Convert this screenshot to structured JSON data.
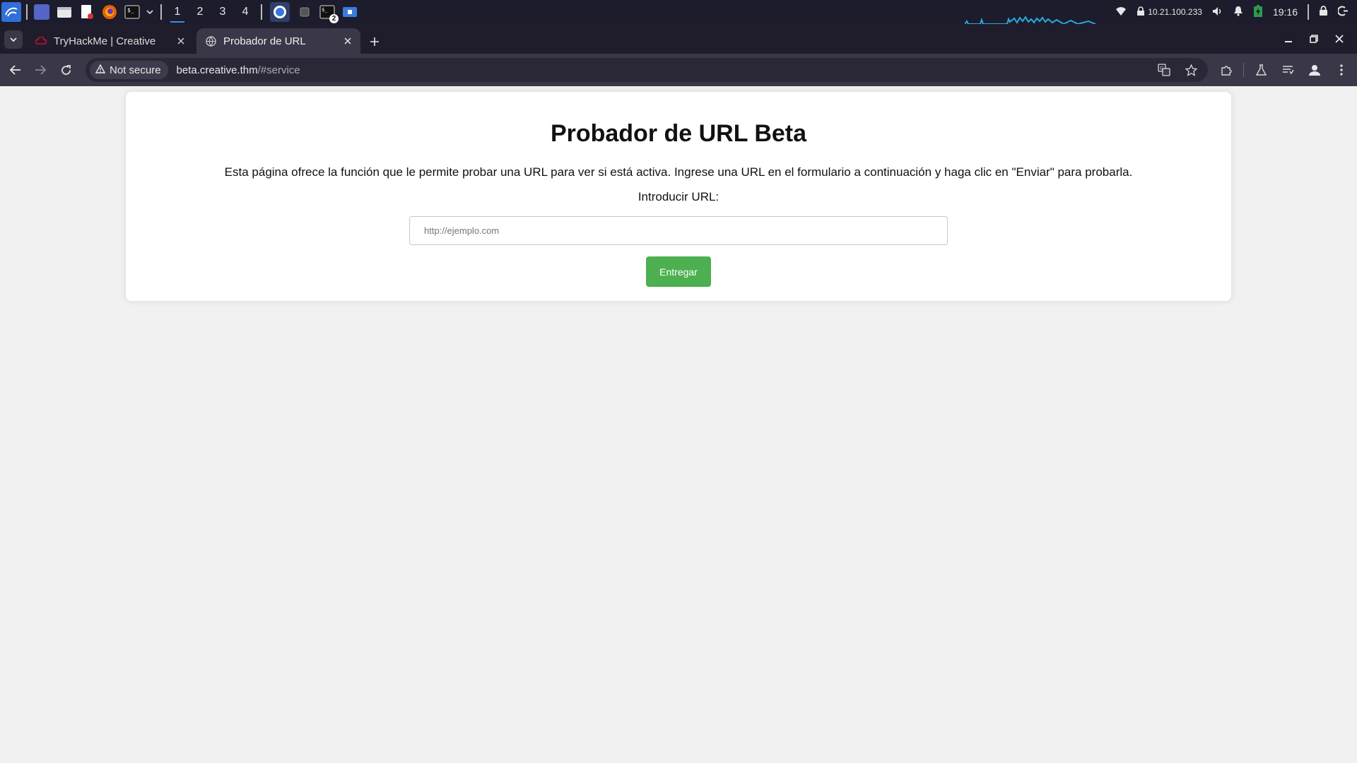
{
  "taskbar": {
    "workspaces": [
      "1",
      "2",
      "3",
      "4"
    ],
    "terminal_badge": "2",
    "ip_address": "10.21.100.233",
    "clock": "19:16"
  },
  "tabs": [
    {
      "title": "TryHackMe | Creative",
      "icon": "tryhackme-logo-icon"
    },
    {
      "title": "Probador de URL",
      "icon": "globe-icon",
      "active": true
    }
  ],
  "toolbar": {
    "security_label": "Not secure",
    "url_host": "beta.creative.thm",
    "url_path": "/#service"
  },
  "page": {
    "title": "Probador de URL Beta",
    "description": "Esta página ofrece la función que le permite probar una URL para ver si está activa. Ingrese una URL en el formulario a continuación y haga clic en \"Enviar\" para probarla.",
    "input_label": "Introducir URL:",
    "input_placeholder": "http://ejemplo.com",
    "input_value": "",
    "submit_label": "Entregar"
  },
  "colors": {
    "submit_bg": "#4caf50",
    "page_bg": "#f1f1f1",
    "browser_chrome": "#3a3848"
  }
}
